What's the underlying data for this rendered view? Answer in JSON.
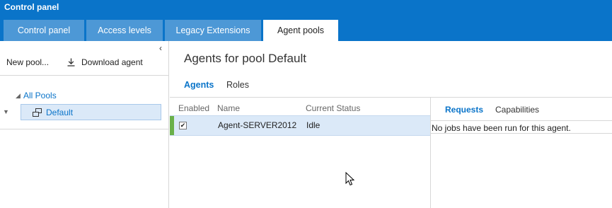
{
  "header": {
    "title": "Control panel",
    "tabs": [
      {
        "label": "Control panel"
      },
      {
        "label": "Access levels"
      },
      {
        "label": "Legacy Extensions"
      },
      {
        "label": "Agent pools"
      }
    ]
  },
  "left": {
    "new_pool": "New pool...",
    "download_agent": "Download agent",
    "tree": {
      "root": "All Pools",
      "items": [
        {
          "label": "Default"
        }
      ]
    }
  },
  "main": {
    "title": "Agents for pool Default",
    "subtabs": [
      {
        "label": "Agents"
      },
      {
        "label": "Roles"
      }
    ],
    "grid": {
      "columns": [
        "Enabled",
        "Name",
        "Current Status"
      ],
      "rows": [
        {
          "enabled": true,
          "name": "Agent-SERVER2012",
          "status": "Idle"
        }
      ]
    }
  },
  "details": {
    "tabs": [
      {
        "label": "Requests"
      },
      {
        "label": "Capabilities"
      }
    ],
    "message": "No jobs have been run for this agent."
  },
  "colors": {
    "accent": "#0a74c9",
    "tab": "#4d98d6",
    "selected": "#dbe9f8",
    "online": "#6ab04a"
  }
}
